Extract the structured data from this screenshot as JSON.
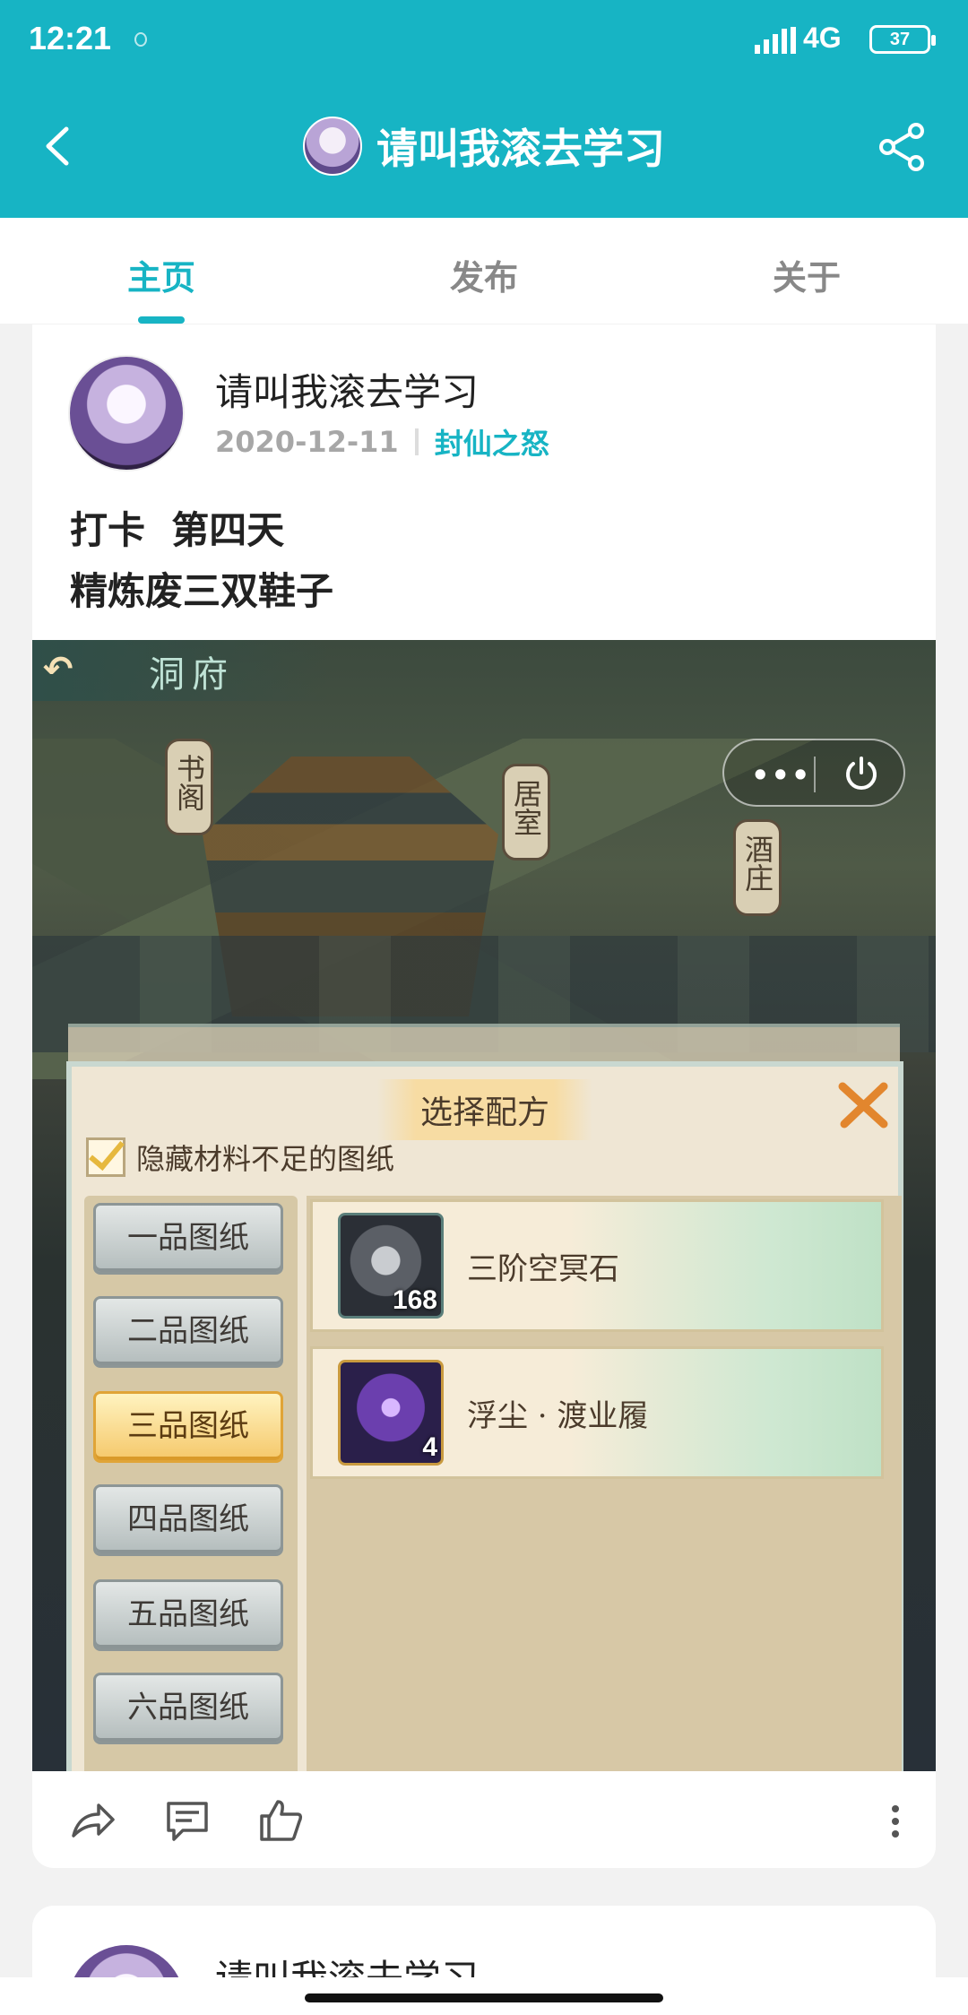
{
  "status_bar": {
    "time": "12:21",
    "network": "4G",
    "battery": "37"
  },
  "header": {
    "title": "请叫我滚去学习"
  },
  "tabs": [
    {
      "label": "主页",
      "active": true
    },
    {
      "label": "发布",
      "active": false
    },
    {
      "label": "关于",
      "active": false
    }
  ],
  "post": {
    "author": "请叫我滚去学习",
    "date": "2020-12-11",
    "topic": "封仙之怒",
    "text_line1": "打卡  第四天",
    "text_line2": "精炼废三双鞋子",
    "game": {
      "back_label": "↶",
      "location": "洞府",
      "signs": [
        "书阁",
        "居室",
        "酒庄"
      ],
      "menu_dots": "•••",
      "dialog_title": "选择配方",
      "hide_checkbox_label": "隐藏材料不足的图纸",
      "grades": [
        "一品图纸",
        "二品图纸",
        "三品图纸",
        "四品图纸",
        "五品图纸",
        "六品图纸"
      ],
      "active_grade": "三品图纸",
      "recipes": [
        {
          "name": "三阶空冥石",
          "qty": "168",
          "icon": "stone-icon"
        },
        {
          "name": "浮尘 · 渡业履",
          "qty": "4",
          "icon": "boot-icon"
        }
      ]
    }
  },
  "next_post": {
    "author": "请叫我滚去学习"
  },
  "colors": {
    "accent": "#17b4c4"
  }
}
